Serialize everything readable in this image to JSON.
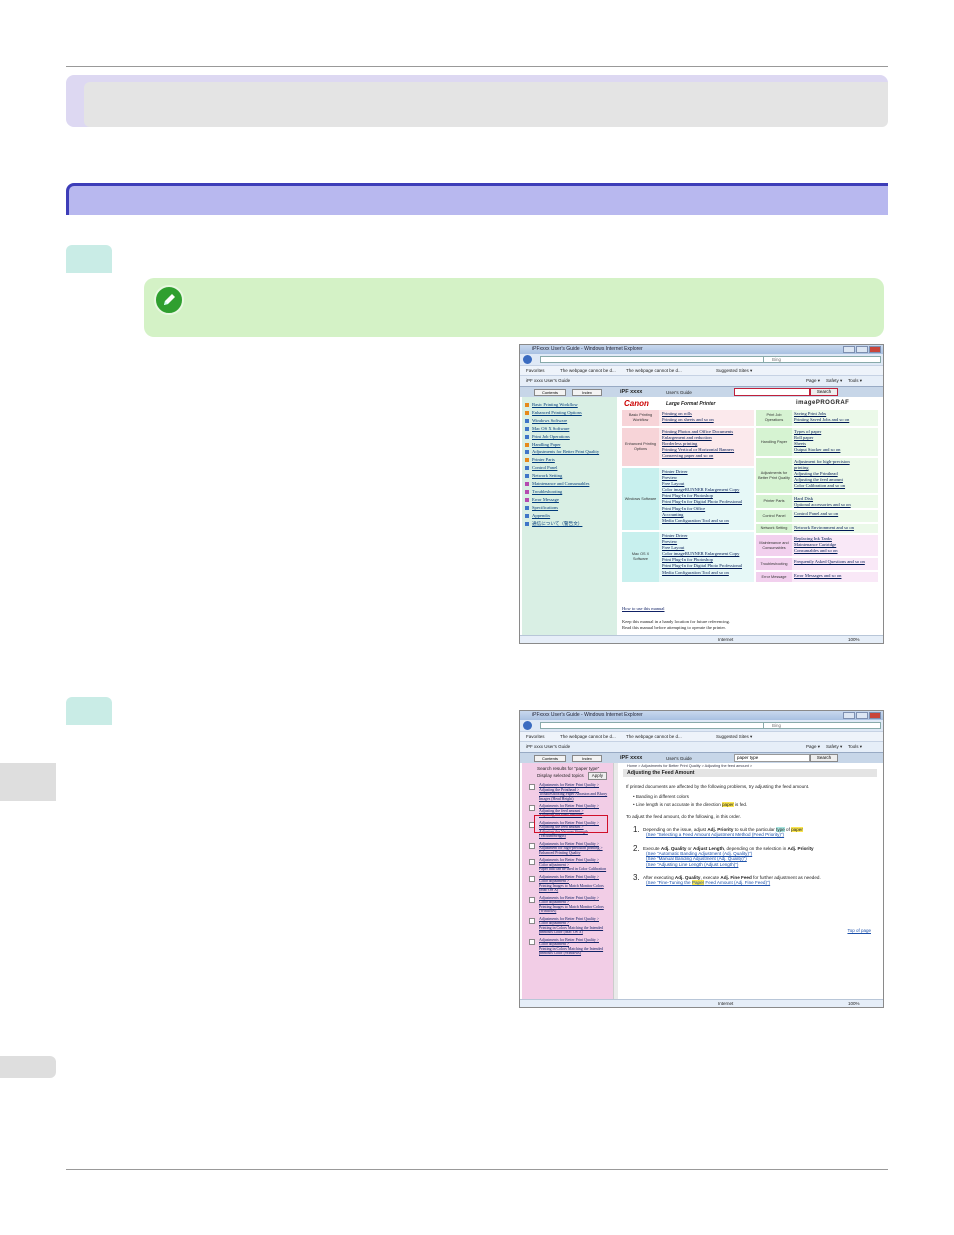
{
  "screenshot1": {
    "window_title": "iPFxxxx User's Guide - Windows Internet Explorer",
    "search_placeholder": "Bing",
    "favorites": [
      "Favorites",
      "The webpage cannot be d...",
      "The webpage cannot be d...",
      "Suggested Sites ▾"
    ],
    "command_tab": "iPF xxxx  User's Guide",
    "command_bar": [
      "Page ▾",
      "Safety ▾",
      "Tools ▾"
    ],
    "tabs": [
      "Contents",
      "Index"
    ],
    "product": "iPF xxxx",
    "users_guide": "User's Guide",
    "search_button": "Search",
    "brand": "Canon",
    "large_format": "Large Format Printer",
    "imageprograf": "imagePROGRAF",
    "toc": [
      {
        "label": "Basic Printing Workflow",
        "color": "o"
      },
      {
        "label": "Enhanced Printing Options",
        "color": "o"
      },
      {
        "label": "Windows Software",
        "color": "b"
      },
      {
        "label": "Mac OS X Software",
        "color": "b"
      },
      {
        "label": "Print Job Operations",
        "color": "b"
      },
      {
        "label": "Handling Paper",
        "color": "o"
      },
      {
        "label": "Adjustments for Better Print Quality",
        "color": "b"
      },
      {
        "label": "Printer Parts",
        "color": "o"
      },
      {
        "label": "Control Panel",
        "color": "b"
      },
      {
        "label": "Network Setting",
        "color": "b"
      },
      {
        "label": "Maintenance and Consumables",
        "color": "p"
      },
      {
        "label": "Troubleshooting",
        "color": "p"
      },
      {
        "label": "Error Message",
        "color": "p"
      },
      {
        "label": "Specifications",
        "color": "b"
      },
      {
        "label": "Appendix",
        "color": "b"
      },
      {
        "label": "通信について（警告文）",
        "color": "b"
      }
    ],
    "grid_left": [
      {
        "label": "Basic Printing Workflow",
        "links": [
          "Printing on rolls",
          "Printing on sheets  and so on"
        ]
      },
      {
        "label": "Enhanced Printing Options",
        "links": [
          "Printing Photos and Office Documents",
          "Enlargement and reduction",
          "Borderless printing",
          "Printing Vertical or Horizontal Banners",
          "Conserving paper  and so on"
        ]
      },
      {
        "label": "Windows Software",
        "links": [
          "Printer Driver",
          "Preview",
          "Free Layout",
          "Color imageRUNNER Enlargement Copy",
          "Print Plug-In for Photoshop",
          "Print Plug-In for Digital Photo Professional",
          "Print Plug-In for Office",
          "Accounting",
          "Media Configuration Tool  and so on"
        ]
      },
      {
        "label": "Mac OS X Software",
        "links": [
          "Printer Driver",
          "Preview",
          "Free Layout",
          "Color imageRUNNER Enlargement Copy",
          "Print Plug-In for Photoshop",
          "Print Plug-In for Digital Photo Professional",
          "Media Configuration Tool  and so on"
        ]
      }
    ],
    "grid_right": [
      {
        "label": "Print Job Operations",
        "links": [
          "Saving Print Jobs",
          "Printing Saved Jobs  and so on"
        ]
      },
      {
        "label": "Handling Paper",
        "links": [
          "Types of paper",
          "Roll paper",
          "Sheets",
          "Output Stacker  and so on"
        ]
      },
      {
        "label": "Adjustments for Better Print Quality",
        "links": [
          "Adjustment for high-precision",
          "printing",
          "Adjusting the Printhead",
          "Adjusting the feed amount",
          "Color Calibration  and so on"
        ]
      },
      {
        "label": "Printer Parts",
        "links": [
          "Hard Disk",
          "Optional accessories  and so on"
        ]
      },
      {
        "label": "Control Panel",
        "links": [
          "Control Panel  and so on"
        ]
      },
      {
        "label": "Network Setting",
        "links": [
          "Network Environment  and so on"
        ]
      },
      {
        "label": "Maintenance and Consumables",
        "links": [
          "Replacing Ink Tanks",
          "Maintenance Cartridge",
          "Consumables  and so on"
        ]
      },
      {
        "label": "Troubleshooting",
        "links": [
          "Frequently Asked Questions  and so on"
        ]
      },
      {
        "label": "Error Message",
        "links": [
          "Error Messages  and so on"
        ]
      }
    ],
    "how_to": "How to use this manual",
    "keep": "Keep this manual in a handy location for future referencing.",
    "read": "Read this manual before attempting to operate the printer.",
    "status_internet": "Internet",
    "zoom": "100%"
  },
  "screenshot2": {
    "window_title": "iPFxxxx User's Guide - Windows Internet Explorer",
    "search_placeholder": "Bing",
    "favorites": [
      "Favorites",
      "The webpage cannot be d...",
      "The webpage cannot be d...",
      "Suggested Sites ▾"
    ],
    "command_tab": "iPF xxxx  User's Guide",
    "command_bar": [
      "Page ▾",
      "Safety ▾",
      "Tools ▾"
    ],
    "tabs": [
      "Contents",
      "Index"
    ],
    "product": "iPF xxxx",
    "users_guide": "User's Guide",
    "search_value": "paper type",
    "search_button": "Search",
    "results_header": "Search results for \"paper type\"",
    "display_label": "Display selected topics",
    "apply": "Apply",
    "results": [
      "Adjustments for Better Print Quality >\nAdjusting the Printhead >\nTroubleshooting Paper Abrasion and Blurry\nImages (Head Height)",
      "Adjustments for Better Print Quality >\nAdjusting the feed amount >\nAdjusting the Feed Amount",
      "Adjustments for Better Print Quality >\nAdjusting the feed amount >\nAdjusting the Vacuum Strength\n(VacuumStrngth)",
      "Adjustments for Better Print Quality >\nAdjustment for high-precision printing >\nEnhanced Printing Quality",
      "Adjustments for Better Print Quality >\nColor adjustment >\nPaper that can be used in Color Calibration",
      "Adjustments for Better Print Quality >\nColor adjustment >\nPrinting Images to Match Monitor Colors\n(Mac OS X)",
      "Adjustments for Better Print Quality >\nColor adjustment >\nPrinting Images to Match Monitor Colors\n(Windows)",
      "Adjustments for Better Print Quality >\nColor adjustment >\nPrinting in Colors Matching the Intended\nprintouts Color (Mac OS X)",
      "Adjustments for Better Print Quality >\nColor adjustment >\nPrinting in Colors Matching the Intended\nprintouts Color (Windows)"
    ],
    "crumb": "Home > Adjustments for Better Print Quality > Adjusting the feed amount >",
    "heading": "Adjusting the Feed Amount",
    "intro": "If printed documents are affected by the following problems, try adjusting the feed amount.",
    "bullet1": "• Banding in different colors",
    "bullet2_a": "• Line length is not accurate in the direction ",
    "bullet2_mark": "paper",
    "bullet2_b": " is fed.",
    "to_adjust": "To adjust the feed amount, do the following, in this order.",
    "step1_a": "Depending on the issue, adjust ",
    "step1_bold": "Adj. Priority",
    "step1_b": " to suit the particular ",
    "step1_mark1": "type",
    "step1_c": " of ",
    "step1_mark2": "paper",
    "step1_see": "(See \"Selecting a Feed Amount Adjustment Method (Feed Priority)\")",
    "step2_a": "Execute ",
    "step2_b1": "Adj. Quality",
    "step2_mid": " or ",
    "step2_b2": "Adjust Length",
    "step2_c": ", depending on the selection in ",
    "step2_b3": "Adj. Priority",
    "step2_see1": "(See \"Automatic Banding Adjustment (Adj. Quality)\")",
    "step2_see2": "(See \"Manual Banding Adjustment (Adj. Quality)\")",
    "step2_see3": "(See \"Adjusting Line Length (Adjust Length)\")",
    "step3_a": "After executing ",
    "step3_b1": "Adj. Quality",
    "step3_c": ", execute ",
    "step3_b2": "Adj. Fine Feed",
    "step3_d": " for further adjustment as needed.",
    "step3_see_a": "(See \"Fine-Tuning the ",
    "step3_see_mark": "Paper",
    "step3_see_b": " Feed Amount (Adj. Fine Feed)\")",
    "top_of_page": "Top of page",
    "status_internet": "Internet",
    "zoom": "100%"
  }
}
